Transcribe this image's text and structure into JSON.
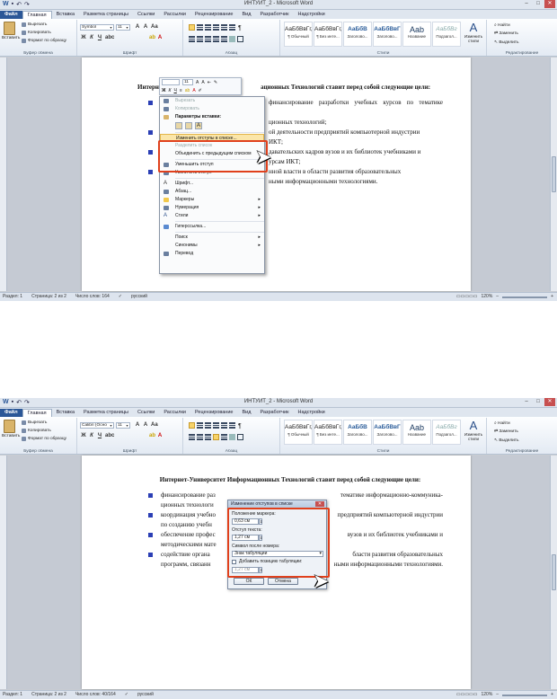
{
  "window_title": "ИНТУИТ_2 - Microsoft Word",
  "tabs": [
    "Файл",
    "Главная",
    "Вставка",
    "Разметка страницы",
    "Ссылки",
    "Рассылки",
    "Рецензирование",
    "Вид",
    "Разработчик",
    "Надстройки"
  ],
  "clipboard": {
    "paste": "Вставить",
    "cut": "Вырезать",
    "copy": "Копировать",
    "format_painter": "Формат по образцу",
    "group": "Буфер обмена"
  },
  "font_group": {
    "label": "Шрифт",
    "size": "11",
    "font_shot1": "Symbol",
    "font_shot2": "Calibri (Осно"
  },
  "paragraph_group": {
    "label": "Абзац"
  },
  "styles_group": {
    "label": "Стили",
    "items": [
      {
        "sample": "АаБбВвГг,",
        "name": "¶ Обычный"
      },
      {
        "sample": "АаБбВвГг,",
        "name": "¶ Без инте..."
      },
      {
        "sample": "АаБбВ",
        "name": "Заголово..."
      },
      {
        "sample": "АаБбВвГ",
        "name": "Заголово..."
      },
      {
        "sample": "Aab",
        "name": "Название"
      },
      {
        "sample": "АаБбВг",
        "name": "Подзагол..."
      }
    ],
    "change": "Изменить стили"
  },
  "editing_group": {
    "label": "Редактирование",
    "find": "Найти",
    "replace": "Заменить",
    "select": "Выделить"
  },
  "doc": {
    "heading": "Интернет-Университет Информационных Технологий ставит перед собой следующие цели:",
    "heading_short": "Интерне",
    "heading_tail": "ационных Технологий ставит перед собой следующие цели:",
    "items": [
      "финансирование разработки учебных курсов по тематике информационно-коммуникационных технологий;",
      "координация учебной и научной деятельности предприятий компьютерной индустрии по созданию учебных курсов по ИКТ;",
      "обеспечение профессорско-преподавательских кадров вузов и их библиотек учебниками и методическими материалами по курсам ИКТ;",
      "содействие органам государственной власти в области развития образовательных программ, связанных с информационными технологиями."
    ],
    "shot1_fragments": [
      "финансирование разработки учебных курсов по тематике информационно-коммуника-",
      "ционных технологий;",
      "ой деятельности предприятий компьютерной индустрии",
      "ИКТ;",
      "давательских кадров вузов и их библиотек учебниками и",
      "урсам ИКТ;",
      "нной власти в области развития образовательных",
      "ными информационными технологиями."
    ],
    "shot2_fragments": [
      "финансирование раз",
      "тематике информационно-коммуника-",
      "ционных технологи",
      "координация учебно",
      "предприятий компьютерной индустрии",
      "по созданию учебн",
      "обеспечение профес",
      "вузов и их библиотек учебниками и",
      "методическими мате",
      "содействие органа",
      "бласти развития образовательных",
      "программ, связанн",
      "ными информационными технологиями."
    ]
  },
  "mini_toolbar": {
    "size": "11"
  },
  "context_menu": {
    "items": [
      {
        "label": "Вырезать",
        "disabled": true
      },
      {
        "label": "Копировать",
        "disabled": true
      },
      {
        "label": "Параметры вставки:",
        "header": true
      },
      {
        "label": "Изменить отступы в списке...",
        "highlight": true
      },
      {
        "label": "Разделить список",
        "disabled": true
      },
      {
        "label": "Объединить с предыдущим списком"
      },
      {
        "label": "Уменьшить отступ"
      },
      {
        "label": "Увеличить отступ"
      },
      {
        "label": "Шрифт..."
      },
      {
        "label": "Абзац..."
      },
      {
        "label": "Маркеры",
        "submenu": true
      },
      {
        "label": "Нумерация",
        "submenu": true
      },
      {
        "label": "Стили",
        "submenu": true
      },
      {
        "label": "Гиперссылка..."
      },
      {
        "label": "Поиск",
        "submenu": true
      },
      {
        "label": "Синонимы",
        "submenu": true
      },
      {
        "label": "Перевод"
      }
    ]
  },
  "dialog": {
    "title": "Изменение отступов в списке",
    "marker_pos_label": "Положение маркера:",
    "marker_pos": "0,63 см",
    "text_indent_label": "Отступ текста:",
    "text_indent": "1,27 см",
    "after_number_label": "Символ после номера:",
    "after_number": "Знак табуляции",
    "add_tab_label": "Добавить позицию табуляции:",
    "tab_pos": "1,27 см",
    "ok": "ОК",
    "cancel": "Отмена"
  },
  "status1": {
    "section": "Раздел: 1",
    "page": "Страница: 2 из 2",
    "words": "Число слов: 164",
    "lang": "русский",
    "zoom": "120%"
  },
  "status2": {
    "section": "Раздел: 1",
    "page": "Страница: 2 из 2",
    "words": "Число слов: 40/164",
    "lang": "русский",
    "zoom": "120%"
  }
}
